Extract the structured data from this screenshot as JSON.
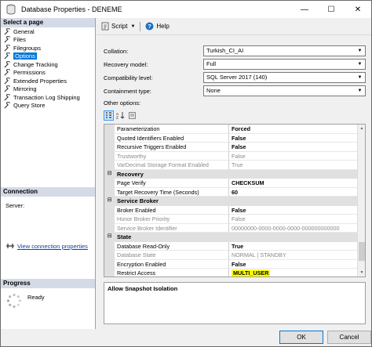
{
  "window": {
    "title": "Database Properties - DENEME",
    "minimize": "—",
    "maximize": "☐",
    "close": "✕"
  },
  "left": {
    "select_page_label": "Select a page",
    "pages": [
      {
        "label": "General"
      },
      {
        "label": "Files"
      },
      {
        "label": "Filegroups"
      },
      {
        "label": "Options"
      },
      {
        "label": "Change Tracking"
      },
      {
        "label": "Permissions"
      },
      {
        "label": "Extended Properties"
      },
      {
        "label": "Mirroring"
      },
      {
        "label": "Transaction Log Shipping"
      },
      {
        "label": "Query Store"
      }
    ],
    "connection_label": "Connection",
    "server_label": "Server:",
    "view_connection": "View connection properties",
    "progress_label": "Progress",
    "progress_status": "Ready"
  },
  "toolbar": {
    "script": "Script",
    "help": "Help"
  },
  "form": {
    "collation_label": "Collation:",
    "collation_value": "Turkish_CI_AI",
    "recovery_label": "Recovery model:",
    "recovery_value": "Full",
    "compat_label": "Compatibility level:",
    "compat_value": "SQL Server 2017 (140)",
    "containment_label": "Containment type:",
    "containment_value": "None",
    "other_options_label": "Other options:"
  },
  "grid": {
    "rows": [
      {
        "name": "Parameterization",
        "value": "Forced"
      },
      {
        "name": "Quoted Identifiers Enabled",
        "value": "False"
      },
      {
        "name": "Recursive Triggers Enabled",
        "value": "False"
      },
      {
        "name": "Trustworthy",
        "value": "False"
      },
      {
        "name": "VarDecimal Storage Format Enabled",
        "value": "True"
      },
      {
        "name": "Recovery",
        "value": ""
      },
      {
        "name": "Page Verify",
        "value": "CHECKSUM"
      },
      {
        "name": "Target Recovery Time (Seconds)",
        "value": "60"
      },
      {
        "name": "Service Broker",
        "value": ""
      },
      {
        "name": "Broker Enabled",
        "value": "False"
      },
      {
        "name": "Honor Broker Priority",
        "value": "False"
      },
      {
        "name": "Service Broker Identifier",
        "value": "00000000-0000-0000-0000-000000000000"
      },
      {
        "name": "State",
        "value": ""
      },
      {
        "name": "Database Read-Only",
        "value": "True"
      },
      {
        "name": "Database State",
        "value": "NORMAL | STANDBY"
      },
      {
        "name": "Encryption Enabled",
        "value": "False"
      },
      {
        "name": "Restrict Access",
        "value": "MULTI_USER"
      }
    ],
    "categories": {
      "recovery": "Recovery",
      "service_broker": "Service Broker",
      "state": "State"
    }
  },
  "description": {
    "title": "Allow Snapshot Isolation"
  },
  "buttons": {
    "ok": "OK",
    "cancel": "Cancel"
  },
  "colors": {
    "accent": "#0078d7",
    "highlight": "#ffff00"
  }
}
